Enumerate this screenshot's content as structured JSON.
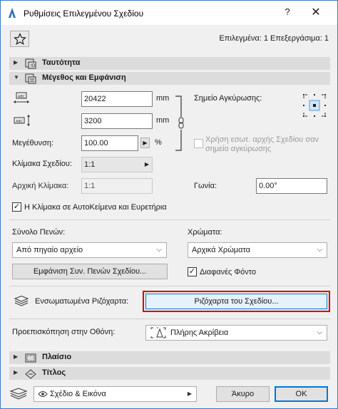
{
  "window": {
    "title": "Ρυθμίσεις Επιλεγμένου Σχεδίου",
    "help": "?",
    "close": "✕"
  },
  "header": {
    "selection_info": "Επιλεγμένα: 1 Επεξεργάσιμα: 1"
  },
  "sections": {
    "identity": "Ταυτότητα",
    "size_appearance": "Μέγεθος και Εμφάνιση",
    "frame": "Πλαίσιο",
    "title": "Τίτλος"
  },
  "size": {
    "width_value": "20422",
    "width_unit": "mm",
    "height_value": "3200",
    "height_unit": "mm",
    "magnification_label": "Μεγέθυνση:",
    "magnification_value": "100.00",
    "magnification_unit": "%",
    "drawing_scale_label": "Κλίμακα Σχεδίου:",
    "drawing_scale_value": "1:1",
    "original_scale_label": "Αρχική Κλίμακα:",
    "original_scale_value": "1:1",
    "anchor_label": "Σημείο Αγκύρωσης:",
    "use_origin_label": "Χρήση εσωτ. αρχής Σχεδίου σαν σημείο αγκύρωσης",
    "angle_label": "Γωνία:",
    "angle_value": "0.00°",
    "scale_text_label": "Η Κλίμακα σε ΑυτοΚείμενα και Ευρετήρια"
  },
  "pens": {
    "pen_set_label": "Σύνολο Πενών:",
    "pen_set_value": "Από πηγαίο αρχείο",
    "show_pens_button": "Εμφάνιση Συν. Πενών Σχεδίου...",
    "colors_label": "Χρώματα:",
    "colors_value": "Αρχικά Χρώματα",
    "transparent_bg_label": "Διαφανές Φόντο"
  },
  "embedded": {
    "label": "Ενσωματωμένα Ριζόχαρτα:",
    "button": "Ριζόχαρτα του Σχεδίου..."
  },
  "preview": {
    "label": "Προεπισκόπηση στην Οθόνη:",
    "value": "Πλήρης Ακρίβεια"
  },
  "footer": {
    "view_value": "Σχέδιο & Εικόνα",
    "cancel": "Άκυρο",
    "ok": "OK"
  },
  "colors": {
    "highlight_border": "#d40000",
    "ok_border": "#0078d7",
    "window_border": "#3c78c8"
  }
}
